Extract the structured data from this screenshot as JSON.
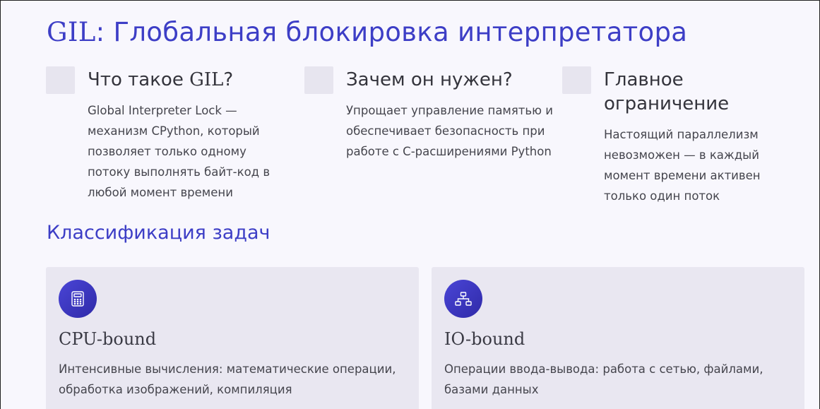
{
  "header": {
    "title_prefix": "GIL",
    "title_rest": ": Глобальная блокировка интерпретатора"
  },
  "features": [
    {
      "title_prefix": "Что такое ",
      "title_serif": "GIL",
      "title_suffix": "?",
      "text": "Global Interpreter Lock — механизм CPython, который позволяет только одному потоку выполнять байт-код в любой момент времени"
    },
    {
      "title": "Зачем он нужен?",
      "text": "Упрощает управление памятью и обеспечивает безопасность при работе с C-расширениями Python"
    },
    {
      "title": "Главное ограничение",
      "text": "Настоящий параллелизм невозможен — в каждый момент времени активен только один поток"
    }
  ],
  "section": {
    "title": "Классификация задач"
  },
  "cards": [
    {
      "icon": "calculator-icon",
      "title": "CPU-bound",
      "text": "Интенсивные вычисления: математические операции, обработка изображений, компиляция"
    },
    {
      "icon": "network-icon",
      "title": "IO-bound",
      "text": "Операции ввода-вывода: работа с сетью, файлами, базами данных"
    }
  ],
  "colors": {
    "accent": "#3d3ec6",
    "background": "#f8f7fd",
    "card": "#e9e7f1"
  }
}
